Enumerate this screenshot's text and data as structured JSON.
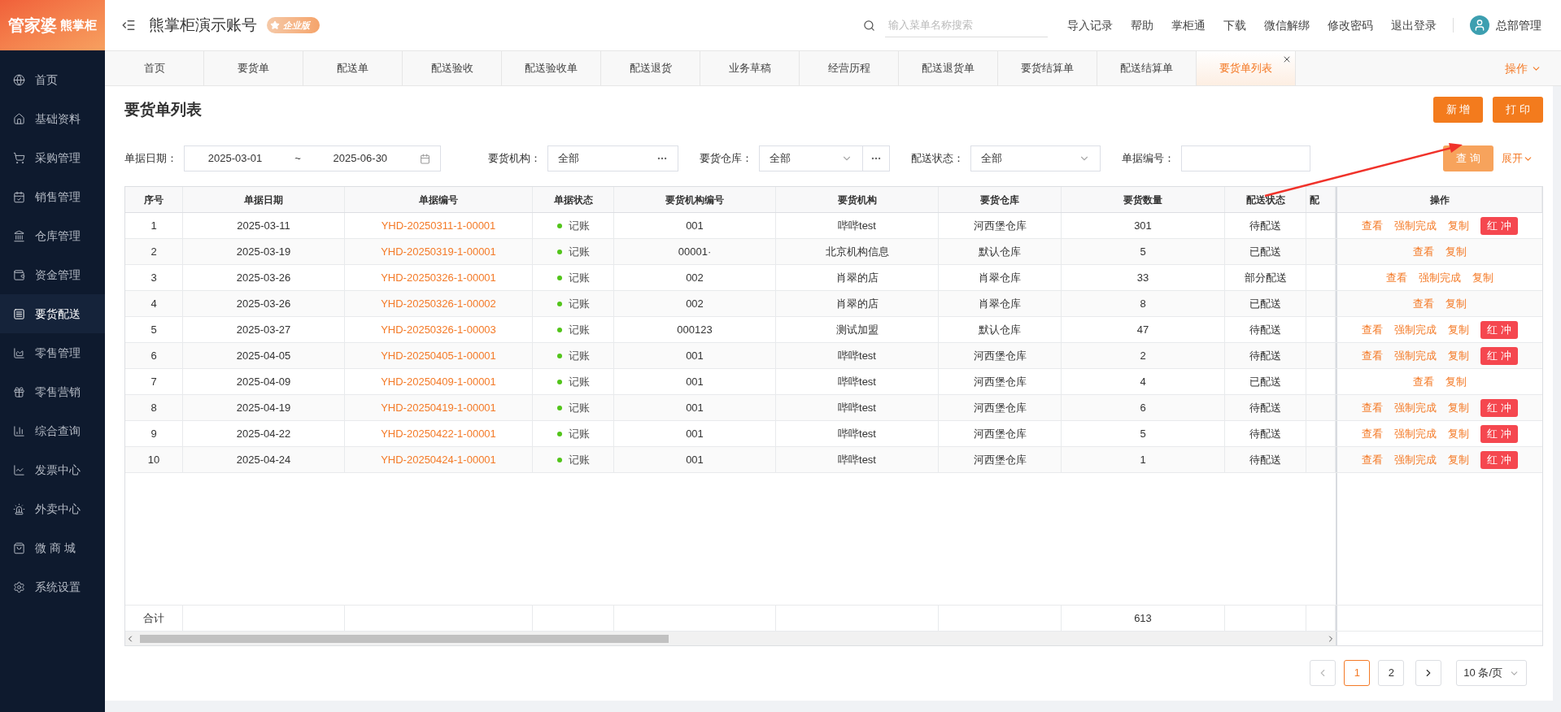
{
  "logo": {
    "primary": "管家婆",
    "secondary": "熊掌柜"
  },
  "sidebar": {
    "items": [
      {
        "label": "首页",
        "selected": false
      },
      {
        "label": "基础资料",
        "selected": false
      },
      {
        "label": "采购管理",
        "selected": false
      },
      {
        "label": "销售管理",
        "selected": false
      },
      {
        "label": "仓库管理",
        "selected": false
      },
      {
        "label": "资金管理",
        "selected": false
      },
      {
        "label": "要货配送",
        "selected": true
      },
      {
        "label": "零售管理",
        "selected": false
      },
      {
        "label": "零售营销",
        "selected": false
      },
      {
        "label": "综合查询",
        "selected": false
      },
      {
        "label": "发票中心",
        "selected": false
      },
      {
        "label": "外卖中心",
        "selected": false
      },
      {
        "label": "微 商 城",
        "selected": false
      },
      {
        "label": "系统设置",
        "selected": false
      }
    ]
  },
  "header": {
    "account": "熊掌柜演示账号",
    "edition": "企业版",
    "search": {
      "placeholder": "输入菜单名称搜索"
    },
    "links": [
      "导入记录",
      "帮助",
      "掌柜通",
      "下载",
      "微信解绑",
      "修改密码",
      "退出登录"
    ],
    "user": "总部管理"
  },
  "tabs": {
    "items": [
      {
        "label": "首页",
        "selected": false
      },
      {
        "label": "要货单",
        "selected": false
      },
      {
        "label": "配送单",
        "selected": false
      },
      {
        "label": "配送验收",
        "selected": false
      },
      {
        "label": "配送验收单",
        "selected": false
      },
      {
        "label": "配送退货",
        "selected": false
      },
      {
        "label": "业务草稿",
        "selected": false
      },
      {
        "label": "经营历程",
        "selected": false
      },
      {
        "label": "配送退货单",
        "selected": false
      },
      {
        "label": "要货结算单",
        "selected": false
      },
      {
        "label": "配送结算单",
        "selected": false
      },
      {
        "label": "要货单列表",
        "selected": true
      }
    ],
    "menu": "操作"
  },
  "page": {
    "title": "要货单列表",
    "actions": [
      "新 增",
      "打 印"
    ]
  },
  "filters": [
    {
      "kind": "date_range",
      "label": "单据日期：",
      "start": "2025-03-01",
      "separator": "~",
      "end": "2025-06-30"
    },
    {
      "kind": "picker",
      "label": "要货机构：",
      "value": "全部"
    },
    {
      "kind": "select_picker",
      "label": "要货仓库：",
      "value": "全部"
    },
    {
      "kind": "select",
      "label": "配送状态：",
      "value": "全部"
    },
    {
      "kind": "input",
      "label": "单据编号："
    }
  ],
  "query_button": "查 询",
  "expand_button": "展开",
  "table": {
    "columns": [
      "序号",
      "单据日期",
      "单据编号",
      "单据状态",
      "要货机构编号",
      "要货机构",
      "要货仓库",
      "要货数量",
      "配送状态",
      "配",
      "操作"
    ],
    "rows": [
      {
        "index": "1",
        "date": "2025-03-11",
        "number": "YHD-20250311-1-00001",
        "status": "记账",
        "org_code": "001",
        "org": "哔哔test",
        "warehouse": "河西堡仓库",
        "qty": "301",
        "delivery": "待配送",
        "actions": [
          {
            "label": "查看",
            "kind": "link"
          },
          {
            "label": "强制完成",
            "kind": "link"
          },
          {
            "label": "复制",
            "kind": "link"
          },
          {
            "label": "红 冲",
            "kind": "danger"
          }
        ]
      },
      {
        "index": "2",
        "date": "2025-03-19",
        "number": "YHD-20250319-1-00001",
        "status": "记账",
        "org_code": "00001·",
        "org": "北京机构信息",
        "warehouse": "默认仓库",
        "qty": "5",
        "delivery": "已配送",
        "actions": [
          {
            "label": "查看",
            "kind": "link"
          },
          {
            "label": "复制",
            "kind": "link"
          }
        ]
      },
      {
        "index": "3",
        "date": "2025-03-26",
        "number": "YHD-20250326-1-00001",
        "status": "记账",
        "org_code": "002",
        "org": "肖翠的店",
        "warehouse": "肖翠仓库",
        "qty": "33",
        "delivery": "部分配送",
        "actions": [
          {
            "label": "查看",
            "kind": "link"
          },
          {
            "label": "强制完成",
            "kind": "link"
          },
          {
            "label": "复制",
            "kind": "link"
          }
        ]
      },
      {
        "index": "4",
        "date": "2025-03-26",
        "number": "YHD-20250326-1-00002",
        "status": "记账",
        "org_code": "002",
        "org": "肖翠的店",
        "warehouse": "肖翠仓库",
        "qty": "8",
        "delivery": "已配送",
        "actions": [
          {
            "label": "查看",
            "kind": "link"
          },
          {
            "label": "复制",
            "kind": "link"
          }
        ]
      },
      {
        "index": "5",
        "date": "2025-03-27",
        "number": "YHD-20250326-1-00003",
        "status": "记账",
        "org_code": "000123",
        "org": "测试加盟",
        "warehouse": "默认仓库",
        "qty": "47",
        "delivery": "待配送",
        "actions": [
          {
            "label": "查看",
            "kind": "link"
          },
          {
            "label": "强制完成",
            "kind": "link"
          },
          {
            "label": "复制",
            "kind": "link"
          },
          {
            "label": "红 冲",
            "kind": "danger"
          }
        ]
      },
      {
        "index": "6",
        "date": "2025-04-05",
        "number": "YHD-20250405-1-00001",
        "status": "记账",
        "org_code": "001",
        "org": "哔哔test",
        "warehouse": "河西堡仓库",
        "qty": "2",
        "delivery": "待配送",
        "actions": [
          {
            "label": "查看",
            "kind": "link"
          },
          {
            "label": "强制完成",
            "kind": "link"
          },
          {
            "label": "复制",
            "kind": "link"
          },
          {
            "label": "红 冲",
            "kind": "danger"
          }
        ]
      },
      {
        "index": "7",
        "date": "2025-04-09",
        "number": "YHD-20250409-1-00001",
        "status": "记账",
        "org_code": "001",
        "org": "哔哔test",
        "warehouse": "河西堡仓库",
        "qty": "4",
        "delivery": "已配送",
        "actions": [
          {
            "label": "查看",
            "kind": "link"
          },
          {
            "label": "复制",
            "kind": "link"
          }
        ]
      },
      {
        "index": "8",
        "date": "2025-04-19",
        "number": "YHD-20250419-1-00001",
        "status": "记账",
        "org_code": "001",
        "org": "哔哔test",
        "warehouse": "河西堡仓库",
        "qty": "6",
        "delivery": "待配送",
        "actions": [
          {
            "label": "查看",
            "kind": "link"
          },
          {
            "label": "强制完成",
            "kind": "link"
          },
          {
            "label": "复制",
            "kind": "link"
          },
          {
            "label": "红 冲",
            "kind": "danger"
          }
        ]
      },
      {
        "index": "9",
        "date": "2025-04-22",
        "number": "YHD-20250422-1-00001",
        "status": "记账",
        "org_code": "001",
        "org": "哔哔test",
        "warehouse": "河西堡仓库",
        "qty": "5",
        "delivery": "待配送",
        "actions": [
          {
            "label": "查看",
            "kind": "link"
          },
          {
            "label": "强制完成",
            "kind": "link"
          },
          {
            "label": "复制",
            "kind": "link"
          },
          {
            "label": "红 冲",
            "kind": "danger"
          }
        ]
      },
      {
        "index": "10",
        "date": "2025-04-24",
        "number": "YHD-20250424-1-00001",
        "status": "记账",
        "org_code": "001",
        "org": "哔哔test",
        "warehouse": "河西堡仓库",
        "qty": "1",
        "delivery": "待配送",
        "actions": [
          {
            "label": "查看",
            "kind": "link"
          },
          {
            "label": "强制完成",
            "kind": "link"
          },
          {
            "label": "复制",
            "kind": "link"
          },
          {
            "label": "红 冲",
            "kind": "danger"
          }
        ]
      }
    ],
    "totals": {
      "label": "合计",
      "qty": "613"
    }
  },
  "pagination": {
    "pages": [
      {
        "label": "1",
        "selected": true
      },
      {
        "label": "2",
        "selected": false
      }
    ],
    "page_size": "10 条/页"
  }
}
